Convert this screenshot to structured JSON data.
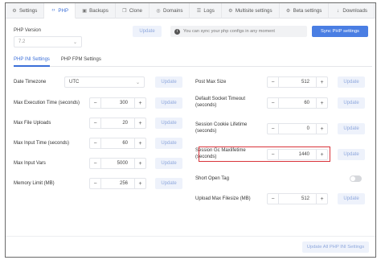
{
  "tabs": [
    {
      "label": "Settings",
      "icon": "gear-icon"
    },
    {
      "label": "PHP",
      "icon": "code-icon"
    },
    {
      "label": "Backups",
      "icon": "backup-icon"
    },
    {
      "label": "Clone",
      "icon": "clone-icon"
    },
    {
      "label": "Domains",
      "icon": "globe-icon"
    },
    {
      "label": "Logs",
      "icon": "logs-icon"
    },
    {
      "label": "Multisite settings",
      "icon": "multisite-icon"
    },
    {
      "label": "Beta settings",
      "icon": "beta-icon"
    },
    {
      "label": "Downloads",
      "icon": "download-icon"
    }
  ],
  "active_tab": "PHP",
  "php_version": {
    "label": "PHP Version",
    "value": "7.2"
  },
  "top_update_label": "Update",
  "info_text": "You can sync your php configs in any moment",
  "sync_label": "Sync PHP settings",
  "subtabs": [
    "PHP INI Settings",
    "PHP FPM Settings"
  ],
  "update_label": "Update",
  "left_settings": [
    {
      "label": "Date Timezone",
      "type": "select",
      "value": "UTC"
    },
    {
      "label": "Max Execution Time (seconds)",
      "type": "stepper",
      "value": "300"
    },
    {
      "label": "Max File Uploads",
      "type": "stepper",
      "value": "20"
    },
    {
      "label": "Max Input Time (seconds)",
      "type": "stepper",
      "value": "60"
    },
    {
      "label": "Max Input Vars",
      "type": "stepper",
      "value": "5000"
    },
    {
      "label": "Memory Limit (MB)",
      "type": "stepper",
      "value": "256"
    }
  ],
  "right_settings": [
    {
      "label": "Post Max Size",
      "type": "stepper",
      "value": "512"
    },
    {
      "label": "Default Socket Timeout (seconds)",
      "type": "stepper",
      "value": "60"
    },
    {
      "label": "Session Cookie Lifetime (seconds)",
      "type": "stepper",
      "value": "0"
    },
    {
      "label": "Session Gc Maxlifetime (seconds)",
      "type": "stepper",
      "value": "1440"
    },
    {
      "label": "Short Open Tag",
      "type": "toggle",
      "value": "off"
    },
    {
      "label": "Upload Max Filesize (MB)",
      "type": "stepper",
      "value": "512"
    }
  ],
  "update_all_label": "Update All PHP INI Settings",
  "colors": {
    "accent": "#3b6fd8",
    "sync_button": "#4a7ee3",
    "highlight": "#d9343b"
  }
}
